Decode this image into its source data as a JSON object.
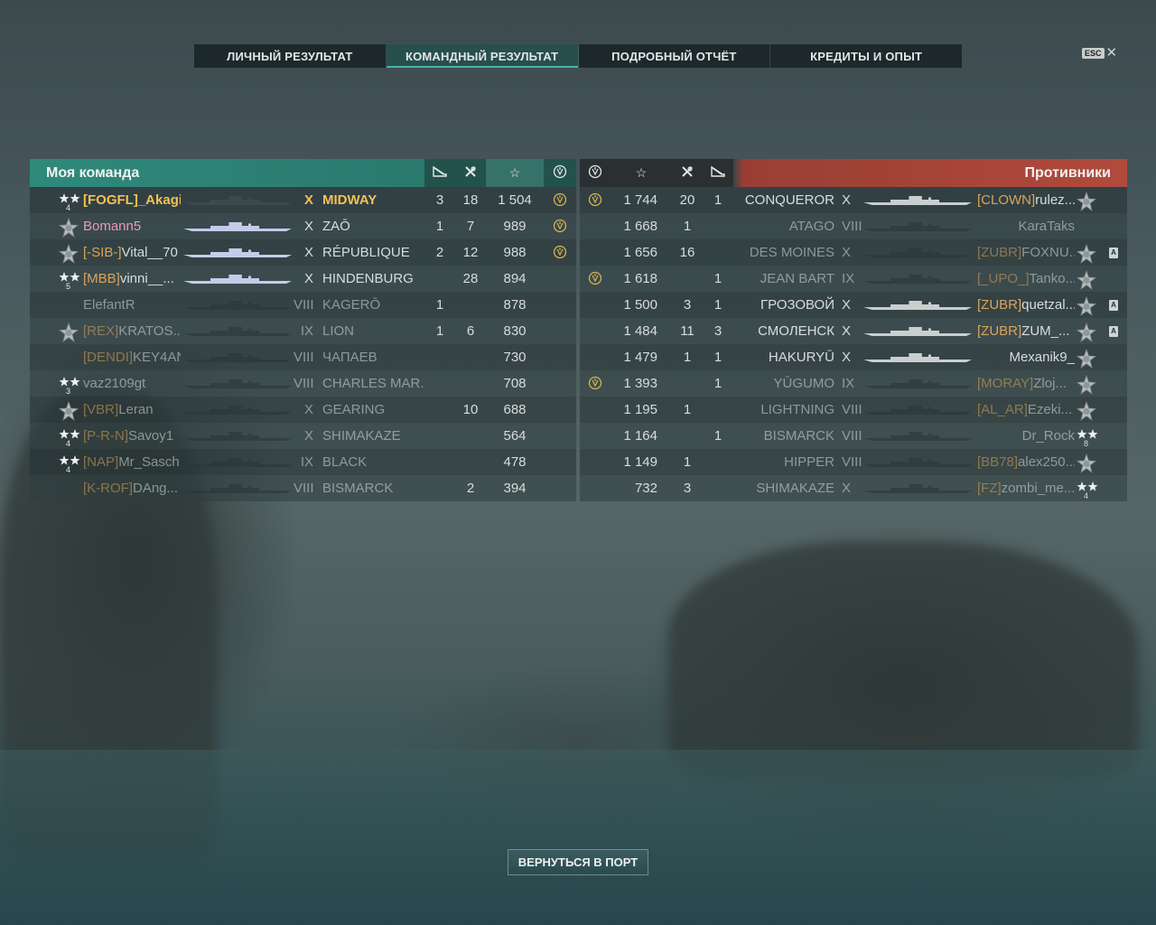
{
  "tabs": [
    {
      "label": "ЛИЧНЫЙ РЕЗУЛЬТАТ",
      "active": false
    },
    {
      "label": "КОМАНДНЫЙ РЕЗУЛЬТАТ",
      "active": true
    },
    {
      "label": "ПОДРОБНЫЙ ОТЧЁТ",
      "active": false
    },
    {
      "label": "КРЕДИТЫ И ОПЫТ",
      "active": false
    }
  ],
  "esc": {
    "key": "ESC",
    "close": "✕"
  },
  "my_team": {
    "title": "Моя команда",
    "columns": [
      "planes-icon",
      "frags-icon",
      "star-icon",
      "medal-icon"
    ],
    "rows": [
      {
        "rank": "4",
        "clan": "[FOGFL]",
        "name": "_Akagi_",
        "tier": "X",
        "ship": "MIDWAY",
        "planes": "3",
        "frags": "18",
        "xp": "1 504",
        "medal": true,
        "highlight": true,
        "dead": false
      },
      {
        "rank": "",
        "clan": "",
        "name": "Bomann5",
        "tier": "X",
        "ship": "ZAŌ",
        "planes": "1",
        "frags": "7",
        "xp": "989",
        "medal": true,
        "highlight": false,
        "dead": false,
        "pink": true
      },
      {
        "rank": "",
        "clan": "[-SIB-]",
        "name": "Vital__70",
        "tier": "X",
        "ship": "RÉPUBLIQUE",
        "planes": "2",
        "frags": "12",
        "xp": "988",
        "medal": true,
        "highlight": false,
        "dead": false
      },
      {
        "rank": "5",
        "clan": "[MBB]",
        "name": "vinni__...",
        "tier": "X",
        "ship": "HINDENBURG",
        "planes": "",
        "frags": "28",
        "xp": "894",
        "medal": false,
        "highlight": false,
        "dead": false
      },
      {
        "rank": "",
        "clan": "",
        "name": "ElefantR",
        "tier": "VIII",
        "ship": "KAGERŌ",
        "planes": "1",
        "frags": "",
        "xp": "878",
        "medal": false,
        "highlight": false,
        "dead": true
      },
      {
        "rank": "",
        "clan": "[REX]",
        "name": "KRATOS...",
        "tier": "IX",
        "ship": "LION",
        "planes": "1",
        "frags": "6",
        "xp": "830",
        "medal": false,
        "highlight": false,
        "dead": true
      },
      {
        "rank": "",
        "clan": "[DENDI]",
        "name": "KEY4AN",
        "tier": "VIII",
        "ship": "ЧАПАЕВ",
        "planes": "",
        "frags": "",
        "xp": "730",
        "medal": false,
        "highlight": false,
        "dead": true
      },
      {
        "rank": "3",
        "clan": "",
        "name": "vaz2109gt",
        "tier": "VIII",
        "ship": "CHARLES MAR...",
        "planes": "",
        "frags": "",
        "xp": "708",
        "medal": false,
        "highlight": false,
        "dead": true
      },
      {
        "rank": "",
        "clan": "[VBR]",
        "name": "Leran",
        "tier": "X",
        "ship": "GEARING",
        "planes": "",
        "frags": "10",
        "xp": "688",
        "medal": false,
        "highlight": false,
        "dead": true
      },
      {
        "rank": "4",
        "clan": "[P-R-N]",
        "name": "Savoy1",
        "tier": "X",
        "ship": "SHIMAKAZE",
        "planes": "",
        "frags": "",
        "xp": "564",
        "medal": false,
        "highlight": false,
        "dead": true
      },
      {
        "rank": "4",
        "clan": "[NAP]",
        "name": "Mr_Sasch",
        "tier": "IX",
        "ship": "BLACK",
        "planes": "",
        "frags": "",
        "xp": "478",
        "medal": false,
        "highlight": false,
        "dead": true
      },
      {
        "rank": "",
        "clan": "[K-ROF]",
        "name": "DAng...",
        "tier": "VIII",
        "ship": "BISMARCK",
        "planes": "",
        "frags": "2",
        "xp": "394",
        "medal": false,
        "highlight": false,
        "dead": true
      }
    ]
  },
  "enemy_team": {
    "title": "Противники",
    "rows": [
      {
        "medal": true,
        "xp": "1 744",
        "frags": "20",
        "planes": "1",
        "ship": "CONQUEROR",
        "tier": "X",
        "clan": "[CLOWN]",
        "name": "rulez...",
        "dead": false,
        "abadge": false,
        "rank": ""
      },
      {
        "medal": false,
        "xp": "1 668",
        "frags": "1",
        "planes": "",
        "ship": "ATAGO",
        "tier": "VIII",
        "clan": "",
        "name": "KaraTaks",
        "dead": true,
        "abadge": false,
        "rank": ""
      },
      {
        "medal": false,
        "xp": "1 656",
        "frags": "16",
        "planes": "",
        "ship": "DES MOINES",
        "tier": "X",
        "clan": "[ZUBR]",
        "name": "FOXNU...",
        "dead": true,
        "abadge": true,
        "rank": ""
      },
      {
        "medal": true,
        "xp": "1 618",
        "frags": "",
        "planes": "1",
        "ship": "JEAN BART",
        "tier": "IX",
        "clan": "[_UPO_]",
        "name": "Tanko...",
        "dead": true,
        "abadge": false,
        "rank": ""
      },
      {
        "medal": false,
        "xp": "1 500",
        "frags": "3",
        "planes": "1",
        "ship": "ГРОЗОВОЙ",
        "tier": "X",
        "clan": "[ZUBR]",
        "name": "quetzal...",
        "dead": false,
        "abadge": true,
        "rank": ""
      },
      {
        "medal": false,
        "xp": "1 484",
        "frags": "11",
        "planes": "3",
        "ship": "СМОЛЕНСК",
        "tier": "X",
        "clan": "[ZUBR]",
        "name": "ZUM_...",
        "dead": false,
        "abadge": true,
        "rank": ""
      },
      {
        "medal": false,
        "xp": "1 479",
        "frags": "1",
        "planes": "1",
        "ship": "HAKURYŪ",
        "tier": "X",
        "clan": "",
        "name": "Mexanik9_",
        "dead": false,
        "abadge": false,
        "rank": ""
      },
      {
        "medal": true,
        "xp": "1 393",
        "frags": "",
        "planes": "1",
        "ship": "YŪGUMO",
        "tier": "IX",
        "clan": "[MORAY]",
        "name": "Zloj...",
        "dead": true,
        "abadge": false,
        "rank": ""
      },
      {
        "medal": false,
        "xp": "1 195",
        "frags": "1",
        "planes": "",
        "ship": "LIGHTNING",
        "tier": "VIII",
        "clan": "[AL_AR]",
        "name": "Ezeki...",
        "dead": true,
        "abadge": false,
        "rank": ""
      },
      {
        "medal": false,
        "xp": "1 164",
        "frags": "",
        "planes": "1",
        "ship": "BISMARCK",
        "tier": "VIII",
        "clan": "",
        "name": "Dr_Rock",
        "dead": true,
        "abadge": false,
        "rank": "8"
      },
      {
        "medal": false,
        "xp": "1 149",
        "frags": "1",
        "planes": "",
        "ship": "HIPPER",
        "tier": "VIII",
        "clan": "[BB78]",
        "name": "alex250...",
        "dead": true,
        "abadge": false,
        "rank": ""
      },
      {
        "medal": false,
        "xp": "732",
        "frags": "3",
        "planes": "",
        "ship": "SHIMAKAZE",
        "tier": "X",
        "clan": "[FZ]",
        "name": "zombi_me...",
        "dead": true,
        "abadge": false,
        "rank": "4"
      }
    ]
  },
  "back_button": "ВЕРНУТЬСЯ В ПОРТ",
  "colors": {
    "accent": "#2f8a7b",
    "enemy": "#b04a3c",
    "clan": "#d9a45a",
    "highlight": "#f2c154"
  }
}
